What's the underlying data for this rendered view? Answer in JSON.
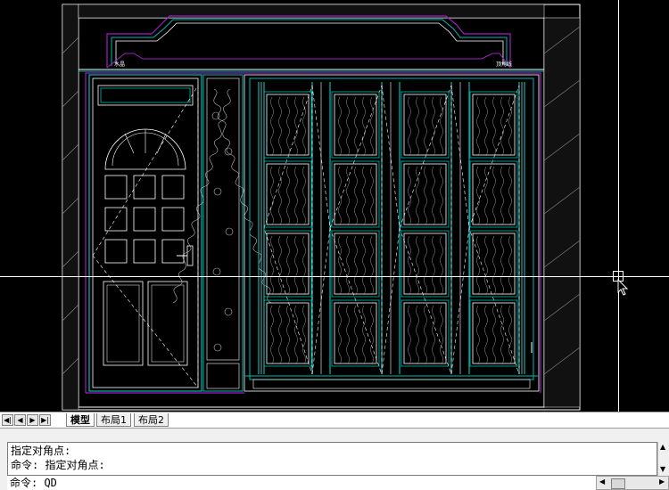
{
  "drawing": {
    "label_left": "水晶",
    "label_right": "顶角线"
  },
  "tabs": {
    "items": [
      "模型",
      "布局1",
      "布局2"
    ],
    "active": "模型"
  },
  "command": {
    "history": [
      "指定对角点:",
      "命令: 指定对角点:"
    ],
    "current": "命令: QD"
  },
  "colors": {
    "background": "#000000",
    "cyan_line": "#00b8b0",
    "magenta_line": "#a020c0",
    "white_line": "#ffffff"
  }
}
